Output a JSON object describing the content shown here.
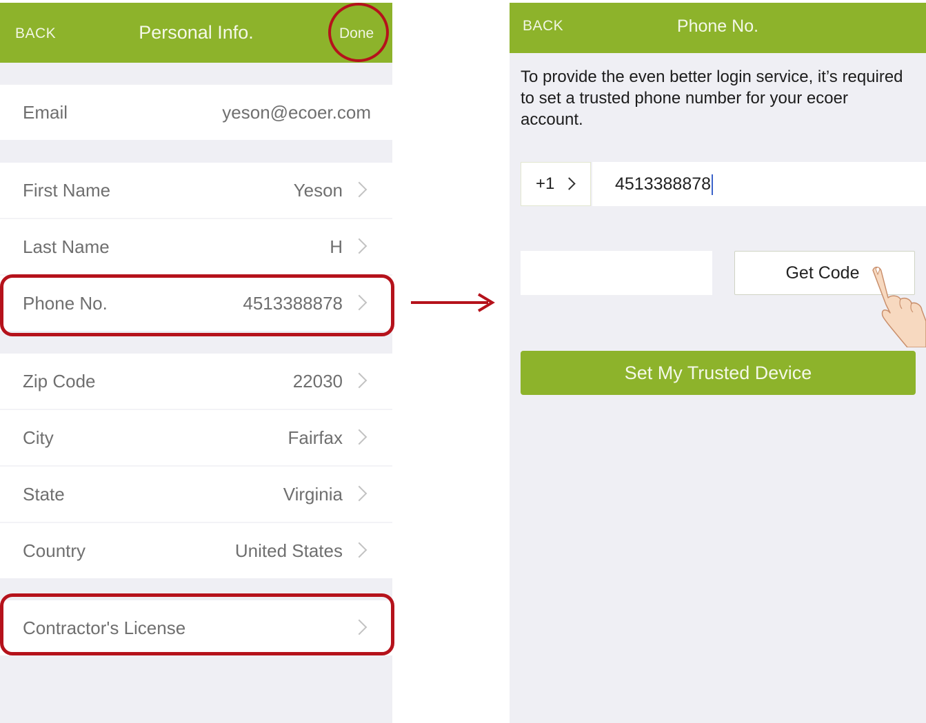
{
  "left_screen": {
    "nav": {
      "back": "BACK",
      "title": "Personal Info.",
      "done": "Done"
    },
    "email": {
      "label": "Email",
      "value": "yeson@ecoer.com"
    },
    "rows": [
      {
        "label": "First Name",
        "value": "Yeson"
      },
      {
        "label": "Last Name",
        "value": "H"
      },
      {
        "label": "Phone No.",
        "value": "4513388878"
      },
      {
        "label": "Zip Code",
        "value": "22030"
      },
      {
        "label": "City",
        "value": "Fairfax"
      },
      {
        "label": "State",
        "value": "Virginia"
      },
      {
        "label": "Country",
        "value": "United States"
      }
    ],
    "license": {
      "label": "Contractor's License",
      "value": ""
    }
  },
  "right_screen": {
    "nav": {
      "back": "BACK",
      "title": "Phone No."
    },
    "intro": "To provide the even better login service, it’s required to set a trusted phone number for your ecoer account.",
    "country_code": "+1",
    "phone_value": "4513388878",
    "verification_code_value": "",
    "get_code_label": "Get Code",
    "submit_label": "Set My Trusted Device"
  },
  "colors": {
    "brand_green": "#8db32b",
    "annotation_red": "#b5121b",
    "background_gray": "#efeff4"
  },
  "icons": [
    "chevron-right-icon",
    "right-arrow-icon",
    "pointing-hand-icon"
  ]
}
